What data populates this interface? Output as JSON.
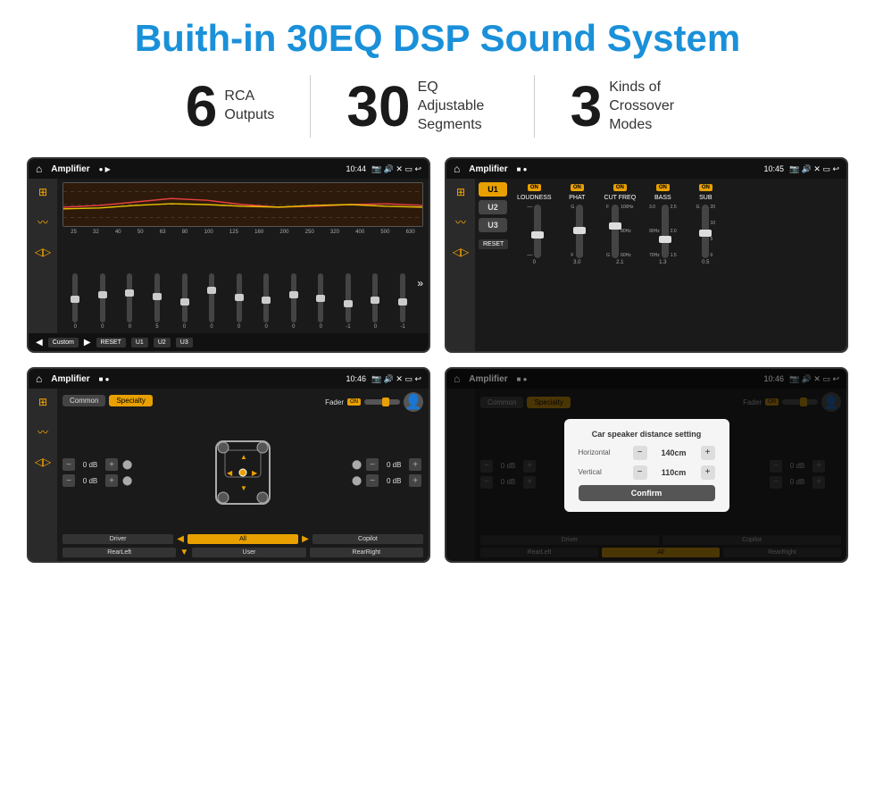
{
  "page": {
    "title": "Buith-in 30EQ DSP Sound System"
  },
  "stats": [
    {
      "number": "6",
      "text": "RCA\nOutputs"
    },
    {
      "number": "30",
      "text": "EQ Adjustable\nSegments"
    },
    {
      "number": "3",
      "text": "Kinds of\nCrossover Modes"
    }
  ],
  "screens": {
    "screen1": {
      "app_name": "Amplifier",
      "time": "10:44",
      "freqs": [
        "25",
        "32",
        "40",
        "50",
        "63",
        "80",
        "100",
        "125",
        "160",
        "200",
        "250",
        "320",
        "400",
        "500",
        "630"
      ],
      "values": [
        "0",
        "0",
        "0",
        "5",
        "0",
        "0",
        "0",
        "0",
        "0",
        "0",
        "-1",
        "0",
        "-1"
      ],
      "bottom_btns": [
        "Custom",
        "RESET",
        "U1",
        "U2",
        "U3"
      ]
    },
    "screen2": {
      "app_name": "Amplifier",
      "time": "10:45",
      "presets": [
        "U1",
        "U2",
        "U3"
      ],
      "channels": [
        "LOUDNESS",
        "PHAT",
        "CUT FREQ",
        "BASS",
        "SUB"
      ],
      "reset_label": "RESET"
    },
    "screen3": {
      "app_name": "Amplifier",
      "time": "10:46",
      "tabs": [
        "Common",
        "Specialty"
      ],
      "fader_label": "Fader",
      "fader_on": "ON",
      "vol_rows": [
        {
          "value": "0 dB"
        },
        {
          "value": "0 dB"
        },
        {
          "value": "0 dB"
        },
        {
          "value": "0 dB"
        }
      ],
      "bottom_btns": [
        "Driver",
        "All",
        "Copilot",
        "RearLeft",
        "User",
        "RearRight"
      ],
      "all_active": true
    },
    "screen4": {
      "app_name": "Amplifier",
      "time": "10:46",
      "tabs": [
        "Common",
        "Specialty"
      ],
      "dialog": {
        "title": "Car speaker distance setting",
        "horizontal_label": "Horizontal",
        "horizontal_value": "140cm",
        "vertical_label": "Vertical",
        "vertical_value": "110cm",
        "confirm_label": "Confirm"
      },
      "right_col": {
        "vol1": "0 dB",
        "vol2": "0 dB"
      },
      "bottom_btns": [
        "Driver",
        "Copilot",
        "RearLeft",
        "RearRight"
      ]
    }
  }
}
